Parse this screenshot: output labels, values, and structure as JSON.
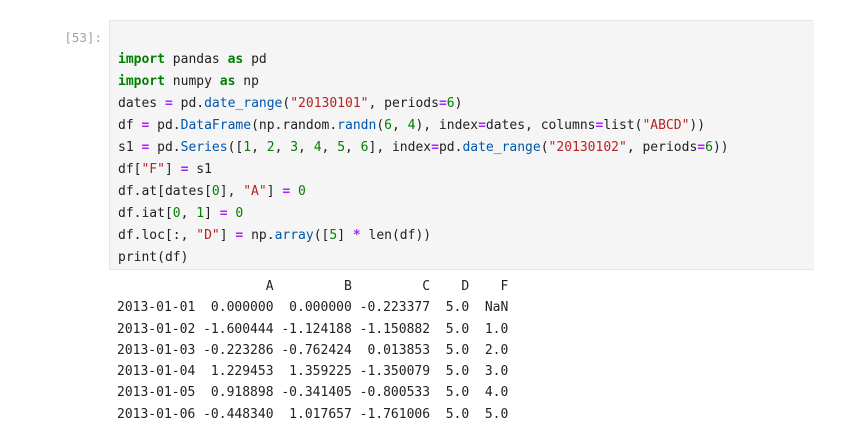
{
  "cell": {
    "prompt": "[53]:",
    "code_lines": [
      "import pandas as pd",
      "import numpy as np",
      "dates = pd.date_range(\"20130101\", periods=6)",
      "df = pd.DataFrame(np.random.randn(6, 4), index=dates, columns=list(\"ABCD\"))",
      "s1 = pd.Series([1, 2, 3, 4, 5, 6], index=pd.date_range(\"20130102\", periods=6))",
      "df[\"F\"] = s1",
      "df.at[dates[0], \"A\"] = 0",
      "df.iat[0, 1] = 0",
      "df.loc[:, \"D\"] = np.array([5] * len(df))",
      "print(df)"
    ]
  },
  "output": {
    "header": "                   A         B         C    D    F",
    "rows": [
      "2013-01-01  0.000000  0.000000 -0.223377  5.0  NaN",
      "2013-01-02 -1.600444 -1.124188 -1.150882  5.0  1.0",
      "2013-01-03 -0.223286 -0.762424  0.013853  5.0  2.0",
      "2013-01-04  1.229453  1.359225 -1.350079  5.0  3.0",
      "2013-01-05  0.918898 -0.341405 -0.800533  5.0  4.0",
      "2013-01-06 -0.448340  1.017657 -1.761006  5.0  5.0"
    ]
  }
}
